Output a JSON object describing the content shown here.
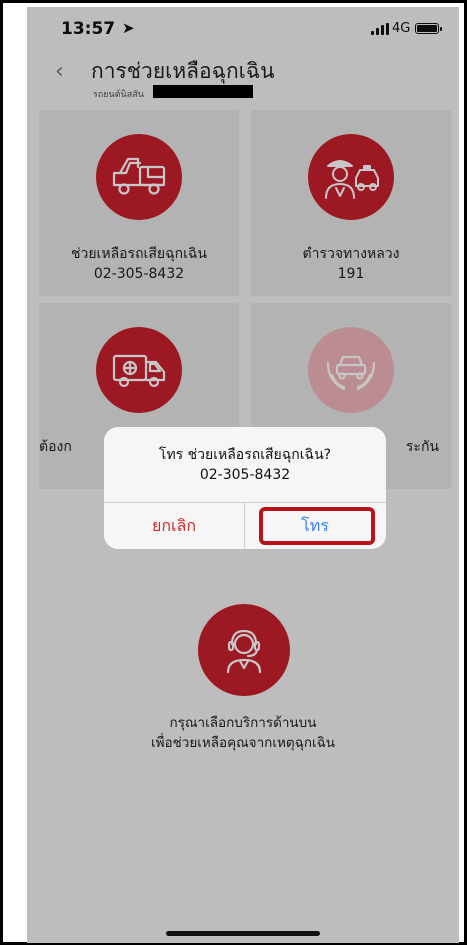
{
  "status_bar": {
    "time": "13:57",
    "location_glyph": "➤",
    "network": "4G"
  },
  "header": {
    "title": "การช่วยเหลือฉุกเฉิน",
    "subtitle": "รถยนต์นิสสัน",
    "back_glyph": "‹"
  },
  "services": [
    {
      "label": "ช่วยเหลือรถเสียฉุกเฉิน",
      "phone": "02-305-8432",
      "icon": "tow-truck-icon"
    },
    {
      "label": "ตำรวจทางหลวง",
      "phone": "191",
      "icon": "police-icon"
    },
    {
      "label": "ต้องก",
      "phone": "",
      "icon": "ambulance-icon"
    },
    {
      "label": "ระกัน",
      "phone": "",
      "icon": "car-insurance-icon"
    }
  ],
  "help": {
    "icon": "call-center-icon",
    "line1": "กรุณาเลือกบริการด้านบน",
    "line2": "เพื่อช่วยเหลือคุณจากเหตุฉุกเฉิน"
  },
  "alert": {
    "message": "โทร ช่วยเหลือรถเสียฉุกเฉิน?",
    "phone": "02-305-8432",
    "cancel_label": "ยกเลิก",
    "call_label": "โทร"
  },
  "colors": {
    "accent": "#c8202e",
    "cancel": "#d32a2a",
    "call": "#3b82f6",
    "highlight": "#b5121b"
  }
}
